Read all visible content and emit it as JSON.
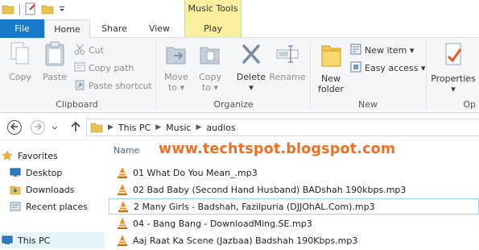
{
  "title_bar": {
    "context_tab_group": "Music Tools"
  },
  "tabs": [
    {
      "label": "File"
    },
    {
      "label": "Home"
    },
    {
      "label": "Share"
    },
    {
      "label": "View"
    },
    {
      "label": "Play"
    }
  ],
  "ribbon": {
    "clipboard": {
      "copy": "Copy",
      "paste": "Paste",
      "cut": "Cut",
      "copy_path": "Copy path",
      "paste_shortcut": "Paste shortcut",
      "group_label": "Clipboard"
    },
    "organize": {
      "move_to": [
        "Move",
        "to ▾"
      ],
      "copy_to": [
        "Copy",
        "to ▾"
      ],
      "delete": [
        "Delete",
        "▾"
      ],
      "rename": "Rename",
      "group_label": "Organize"
    },
    "new": {
      "new_folder": [
        "New",
        "folder"
      ],
      "new_item": "New item ▾",
      "easy_access": "Easy access ▾",
      "group_label": "New"
    },
    "open": {
      "properties": [
        "Properties",
        "▾"
      ],
      "group_label": "Op"
    }
  },
  "address_bar": {
    "crumbs": [
      "This PC",
      "Music",
      "audios"
    ]
  },
  "nav_pane": {
    "favorites": "Favorites",
    "desktop": "Desktop",
    "downloads": "Downloads",
    "recent_places": "Recent places",
    "this_pc": "This PC"
  },
  "file_list": {
    "column_name": "Name",
    "watermark": "www.techtspot.blogspot.com",
    "files": [
      "01 What Do You Mean_.mp3",
      "02 Bad Baby (Second Hand Husband) BADshah 190kbps.mp3",
      "2 Many Girls - Badshah, Fazilpuria (DJJOhAL.Com).mp3",
      "04 - Bang Bang - DownloadMing.SE.mp3",
      "Aaj Raat Ka Scene (Jazbaa) Badshah 190Kbps.mp3"
    ],
    "selected_index": 2
  },
  "colors": {
    "file_tab": "#1979ca",
    "context_tab": "#f9ef9c",
    "watermark": "#ef6f25",
    "vlc_cone": "#f08a1c"
  }
}
